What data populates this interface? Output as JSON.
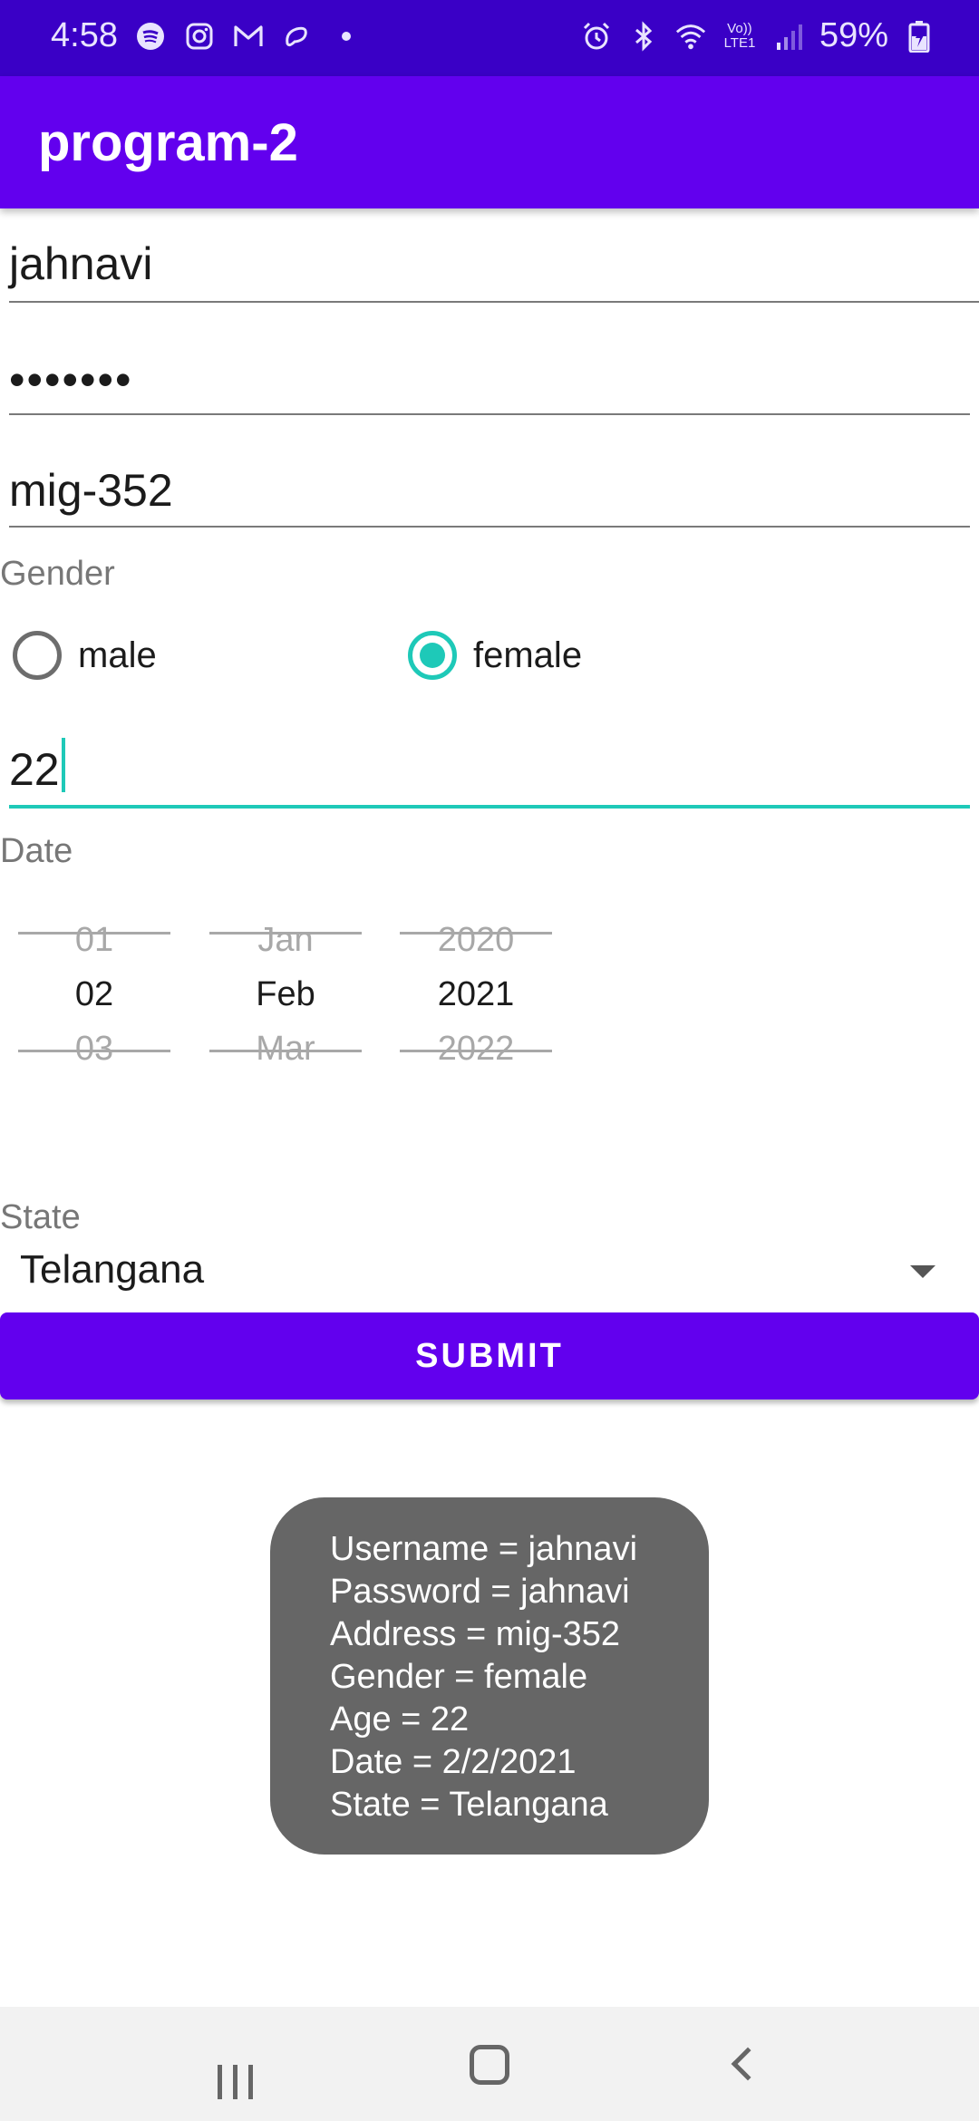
{
  "status_bar": {
    "time": "4:58",
    "left_icons": [
      "spotify-icon",
      "instagram-icon",
      "gmail-icon",
      "airtel-icon",
      "dot-icon"
    ],
    "right_icons": [
      "alarm-icon",
      "bluetooth-icon",
      "wifi-icon",
      "volte-icon",
      "signal-icon"
    ],
    "volte_text": "Vo)) LTE1",
    "battery": "59%"
  },
  "app_bar": {
    "title": "program-2"
  },
  "form": {
    "username": "jahnavi",
    "password_masked": "•••••••",
    "address": "mig-352",
    "gender_label": "Gender",
    "gender_options": [
      {
        "label": "male",
        "checked": false
      },
      {
        "label": "female",
        "checked": true
      }
    ],
    "age": "22",
    "date_label": "Date",
    "date_picker": {
      "day": {
        "prev": "01",
        "current": "02",
        "next": "03"
      },
      "month": {
        "prev": "Jan",
        "current": "Feb",
        "next": "Mar"
      },
      "year": {
        "prev": "2020",
        "current": "2021",
        "next": "2022"
      }
    },
    "state_label": "State",
    "state_value": "Telangana",
    "submit_label": "SUBMIT"
  },
  "toast": {
    "lines": [
      "Username = jahnavi",
      "Password = jahnavi",
      "Address = mig-352",
      "Gender = female",
      "Age = 22",
      "Date = 2/2/2021",
      "State = Telangana"
    ]
  },
  "colors": {
    "status_bar": "#3a00c6",
    "primary": "#6200ee",
    "accent": "#1ec9b8",
    "toast_bg": "#666666"
  }
}
